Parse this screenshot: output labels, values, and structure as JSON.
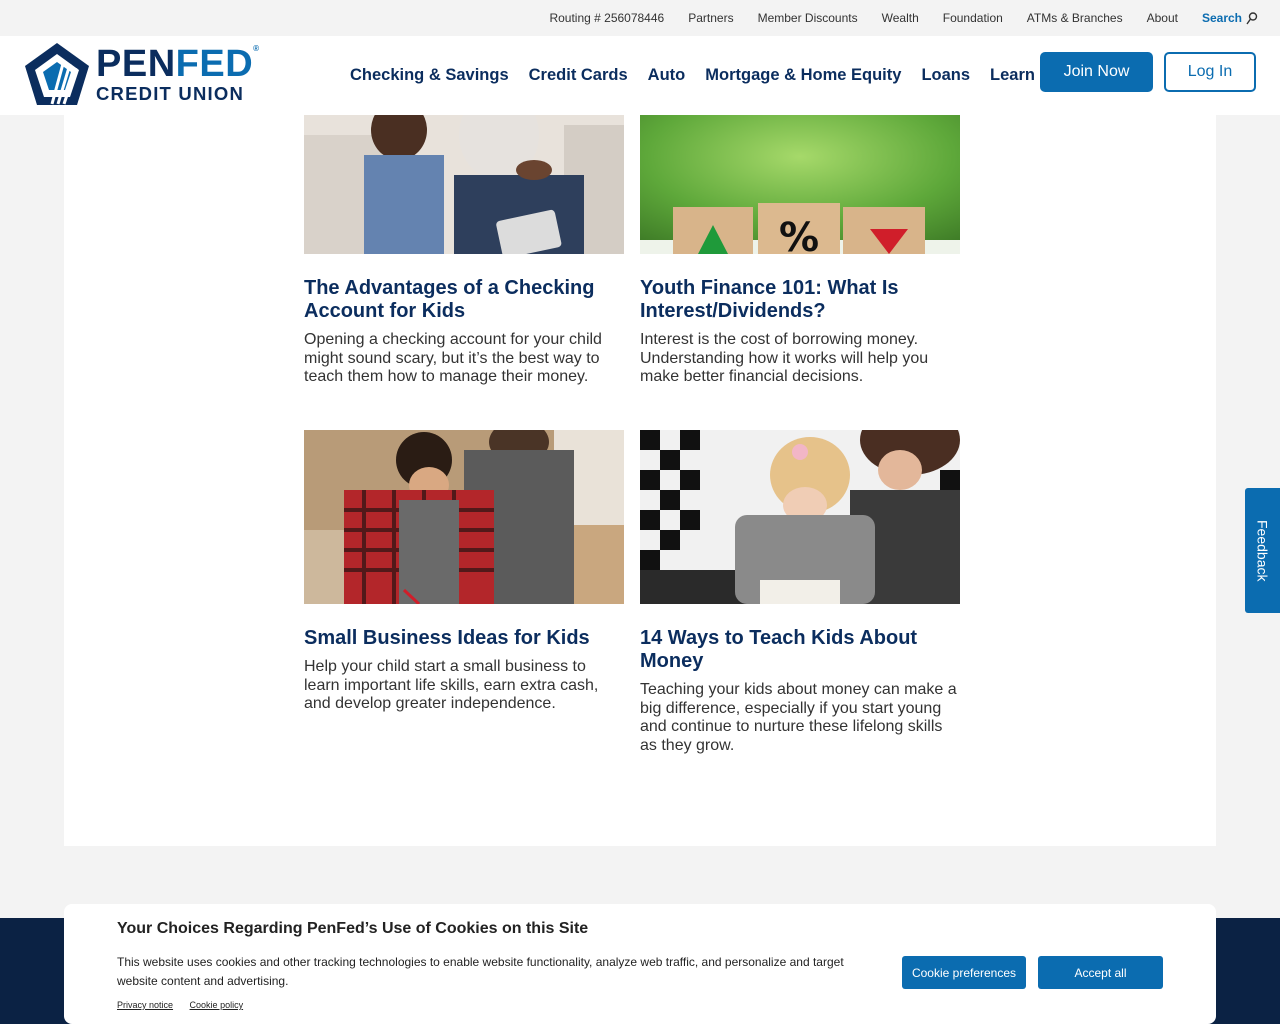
{
  "utility_nav": {
    "routing": "Routing # 256078446",
    "items": [
      "Partners",
      "Member Discounts",
      "Wealth",
      "Foundation",
      "ATMs & Branches",
      "About"
    ],
    "search_label": "Search"
  },
  "logo": {
    "line1_a": "PEN",
    "line1_b": "FED",
    "line2": "CREDIT UNION"
  },
  "main_nav": [
    "Checking & Savings",
    "Credit Cards",
    "Auto",
    "Mortgage & Home Equity",
    "Loans",
    "Learn"
  ],
  "buttons": {
    "join": "Join Now",
    "login": "Log In"
  },
  "articles": [
    {
      "title": "The Advantages of a Checking Account for Kids",
      "desc": "Opening a checking account for your child might sound scary, but it’s the best way to teach them how to manage their money."
    },
    {
      "title": "Youth Finance 101: What Is Interest/Dividends?",
      "desc": "Interest is the cost of borrowing money. Understanding how it works will help you make better financial decisions."
    },
    {
      "title": "Small Business Ideas for Kids",
      "desc": "Help your child start a small business to learn important life skills, earn extra cash, and develop greater independence."
    },
    {
      "title": "14 Ways to Teach Kids About Money",
      "desc": "Teaching your kids about money can make a big difference, especially if you start young and continue to nurture these lifelong skills as they grow."
    }
  ],
  "cookie": {
    "title": "Your Choices Regarding PenFed’s Use of Cookies on this Site",
    "body": "This website uses cookies and other tracking technologies to enable website functionality, analyze web traffic, and personalize and target website content and advertising.",
    "privacy_link": "Privacy notice",
    "cookie_link": "Cookie policy",
    "pref_button": "Cookie preferences",
    "accept_button": "Accept all"
  },
  "feedback_label": "Feedback",
  "colors": {
    "brand_navy": "#0b2d5e",
    "brand_blue": "#0b6cb0",
    "footer": "#0b2244"
  }
}
